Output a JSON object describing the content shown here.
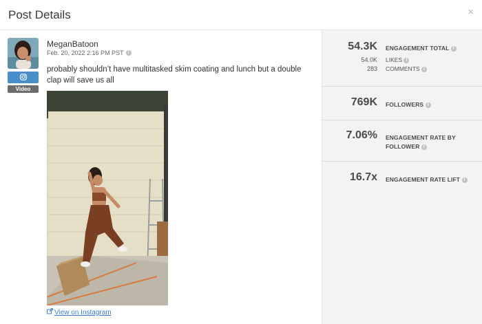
{
  "header": {
    "title": "Post Details",
    "close_glyph": "×"
  },
  "post": {
    "username": "MeganBatoon",
    "date": "Feb. 20, 2022 2:16 PM PST",
    "platform_icon": "instagram-icon",
    "type_badge": "Video",
    "caption": "probably shouldn’t have multitasked skim coating and lunch but a double clap will save us all",
    "view_link": "View on Instagram"
  },
  "metrics": {
    "engagement_total": {
      "value": "54.3K",
      "label": "ENGAGEMENT TOTAL"
    },
    "likes": {
      "value": "54.0K",
      "label": "LIKES"
    },
    "comments": {
      "value": "283",
      "label": "COMMENTS"
    },
    "followers": {
      "value": "769K",
      "label": "FOLLOWERS"
    },
    "engagement_rate": {
      "value": "7.06%",
      "label_line1": "ENGAGEMENT RATE BY",
      "label_line2": "FOLLOWER"
    },
    "engagement_lift": {
      "value": "16.7x",
      "label": "ENGAGEMENT RATE LIFT"
    }
  },
  "colors": {
    "instagram_badge": "#4a8fc9",
    "link": "#3d7fc4",
    "panel_bg": "#f3f3f3"
  }
}
